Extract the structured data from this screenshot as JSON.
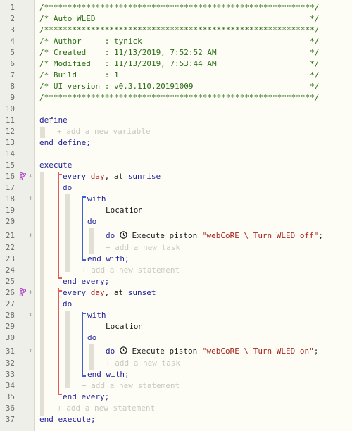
{
  "header_lines": [
    "/**********************************************************/",
    "/* Auto WLED                                              */",
    "/**********************************************************/",
    "/* Author     : tynick                                    */",
    "/* Created    : 11/13/2019, 7:52:52 AM                    */",
    "/* Modified   : 11/13/2019, 7:53:44 AM                    */",
    "/* Build      : 1                                         */",
    "/* UI version : v0.3.110.20191009                         */",
    "/**********************************************************/"
  ],
  "line_numbers": [
    "1",
    "2",
    "3",
    "4",
    "5",
    "6",
    "7",
    "8",
    "9",
    "10",
    "11",
    "12",
    "13",
    "14",
    "15",
    "16",
    "17",
    "18",
    "19",
    "20",
    "21",
    "22",
    "23",
    "24",
    "25",
    "26",
    "27",
    "28",
    "29",
    "30",
    "31",
    "32",
    "33",
    "34",
    "35",
    "36",
    "37"
  ],
  "keywords": {
    "define": "define",
    "end_define": "end define;",
    "execute": "execute",
    "end_execute": "end execute;",
    "every": "every",
    "at": ", at ",
    "do": "do",
    "with": "with",
    "end_with": "end with;",
    "end_every": "end every;"
  },
  "placeholders": {
    "add_variable": "+ add a new variable",
    "add_task": "+ add a new task",
    "add_statement": "+ add a new statement"
  },
  "blocks": [
    {
      "day": "day",
      "event": "sunrise",
      "device": "Location",
      "task_prefix": "Execute piston ",
      "piston": "\"webCoRE \\ Turn WLED off\"",
      "terminator": ";"
    },
    {
      "day": "day",
      "event": "sunset",
      "device": "Location",
      "task_prefix": "Execute piston ",
      "piston": "\"webCoRE \\ Turn WLED on\"",
      "terminator": ";"
    }
  ],
  "icons": {
    "drag": "drag-handle-icon",
    "branch": "restriction-branch-icon",
    "clock": "clock-icon"
  },
  "colors": {
    "comment": "#2a6d14",
    "keyword": "#23239a",
    "value": "#b02a2a",
    "placeholder": "#c9c9c0",
    "restriction_bar": "#e25a5a",
    "with_bar": "#3b63c9"
  }
}
